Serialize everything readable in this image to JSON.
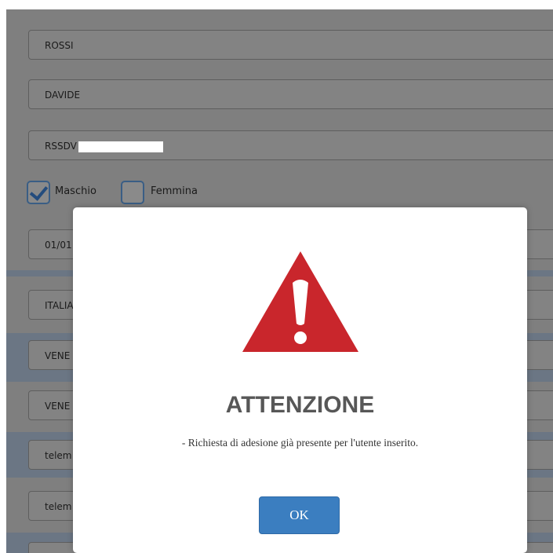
{
  "form": {
    "surname_value": "ROSSI",
    "name_value": "DAVIDE",
    "tax_code_value": "RSSDV",
    "gender": {
      "male_label": "Maschio",
      "male_checked": true,
      "female_label": "Femmina",
      "female_checked": false
    },
    "birth_date_value": "01/01",
    "country_value": "ITALIA",
    "region_value": "VENE",
    "province_value": "VENE",
    "email_value": "telem",
    "email_confirm_value": "telem"
  },
  "modal": {
    "icon": "warning-triangle-icon",
    "title": "ATTENZIONE",
    "message": "- Richiesta di adesione già presente per l'utente inserito.",
    "ok_label": "OK",
    "colors": {
      "icon_red": "#c9262c",
      "button_blue": "#3b7ec0",
      "title_gray": "#575757"
    }
  }
}
